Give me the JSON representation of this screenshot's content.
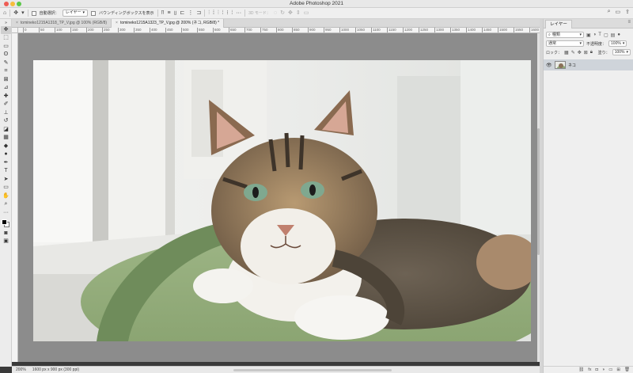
{
  "app": {
    "title": "Adobe Photoshop 2021"
  },
  "options_bar": {
    "auto_select_label": "自動選択：",
    "auto_select_target": "レイヤー",
    "show_transform_label": "バウンディングボックスを表示",
    "mode_3d_label": "3D モード："
  },
  "tabs": [
    {
      "label": "tomineko1215A1318_TP_V.jpg @ 100% (RGB/8)",
      "close": "×"
    },
    {
      "label": "tomineko1215A1323_TP_V.jpg @ 200% (ネコ, RGB/8) *",
      "close": "×"
    }
  ],
  "ruler": {
    "ticks": [
      "0",
      "50",
      "100",
      "150",
      "200",
      "250",
      "300",
      "350",
      "400",
      "450",
      "500",
      "550",
      "600",
      "650",
      "700",
      "750",
      "800",
      "850",
      "900",
      "950",
      "1000",
      "1050",
      "1100",
      "1150",
      "1200",
      "1250",
      "1300",
      "1350",
      "1400",
      "1450",
      "1500",
      "1550",
      "1600"
    ]
  },
  "status": {
    "zoom": "200%",
    "doc_info": "1600 px x 900 px (300 ppi)"
  },
  "layers_panel": {
    "tab_label": "レイヤー",
    "filter_kind": "種類",
    "blend_mode": "通常",
    "opacity_label": "不透明度：",
    "opacity_value": "100%",
    "lock_label": "ロック：",
    "fill_label": "塗り：",
    "fill_value": "100%",
    "layers": [
      {
        "name": "ネコ",
        "visible": true
      }
    ]
  },
  "icons": {
    "eye": "eye-icon",
    "move": "move-tool-icon",
    "home": "home-icon"
  },
  "colors": {
    "selected_layer_bg": "#cfd4da",
    "foreground": "#000000",
    "background": "#ffffff"
  }
}
